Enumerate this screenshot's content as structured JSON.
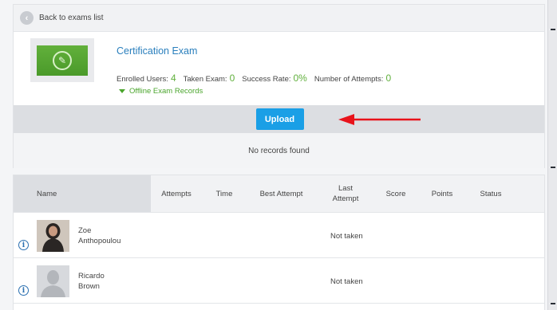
{
  "back": {
    "label": "Back to exams list",
    "icon": "chevron-left-icon"
  },
  "exam": {
    "title": "Certification Exam",
    "stats": [
      {
        "label": "Enrolled Users:",
        "value": "4"
      },
      {
        "label": "Taken Exam:",
        "value": "0"
      },
      {
        "label": "Success Rate:",
        "value": "0%"
      },
      {
        "label": "Number of Attempts:",
        "value": "0"
      }
    ],
    "offline_link": "Offline Exam Records"
  },
  "upload": {
    "label": "Upload"
  },
  "no_records": "No records found",
  "table": {
    "columns": [
      "Name",
      "Attempts",
      "Time",
      "Best Attempt",
      "Last Attempt",
      "Score",
      "Points",
      "Status"
    ],
    "rows": [
      {
        "first": "Zoe",
        "last": "Anthopoulou",
        "last_attempt": "Not taken",
        "avatar": "photo"
      },
      {
        "first": "Ricardo",
        "last": "Brown",
        "last_attempt": "Not taken",
        "avatar": "generic"
      }
    ]
  },
  "colors": {
    "accent_blue": "#1a9fe6",
    "success_green": "#61b03d",
    "annotation_red": "#e8131b"
  }
}
